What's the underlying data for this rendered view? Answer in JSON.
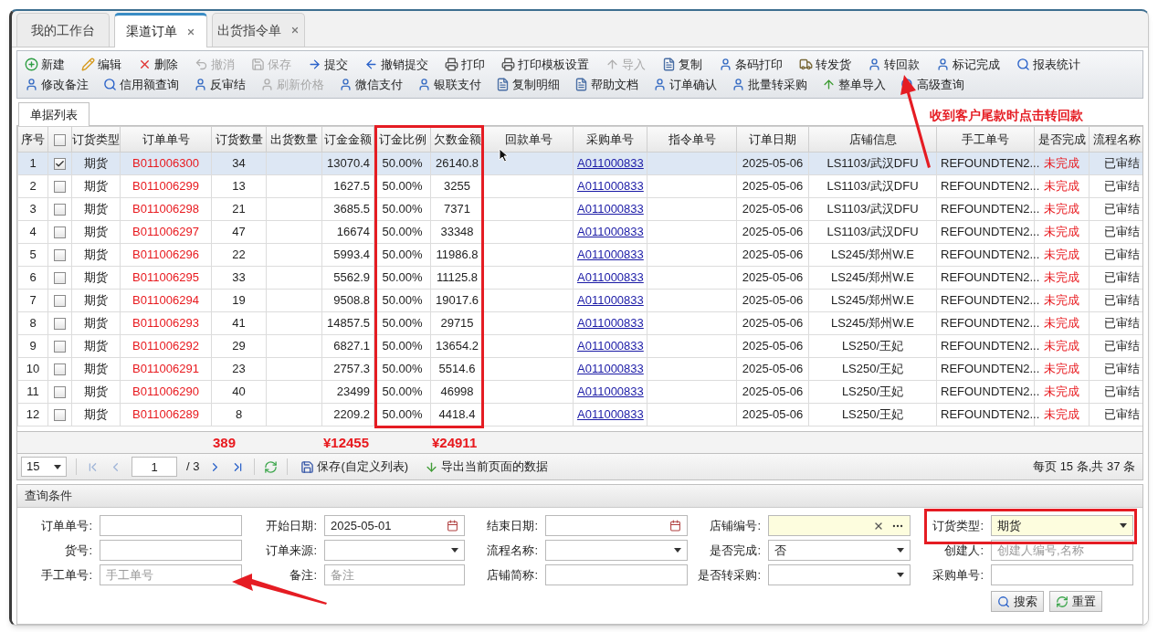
{
  "tabs": [
    {
      "label": "我的工作台",
      "selected": false,
      "closable": false
    },
    {
      "label": "渠道订单",
      "selected": true,
      "closable": true
    },
    {
      "label": "出货指令单",
      "selected": false,
      "closable": true
    }
  ],
  "toolbar": [
    [
      {
        "label": "新建",
        "kind": "add",
        "disabled": false
      },
      {
        "label": "编辑",
        "kind": "edit",
        "disabled": false
      },
      {
        "label": "删除",
        "kind": "delete",
        "disabled": false
      },
      {
        "label": "撤消",
        "kind": "undo",
        "disabled": true
      },
      {
        "label": "保存",
        "kind": "save",
        "disabled": true
      },
      {
        "label": "提交",
        "kind": "forward",
        "disabled": false
      },
      {
        "label": "撤销提交",
        "kind": "back",
        "disabled": false
      },
      {
        "label": "打印",
        "kind": "print",
        "disabled": false
      },
      {
        "label": "打印模板设置",
        "kind": "print",
        "disabled": false
      },
      {
        "label": "导入",
        "kind": "import",
        "disabled": true
      },
      {
        "label": "复制",
        "kind": "doc",
        "disabled": false
      },
      {
        "label": "条码打印",
        "kind": "user",
        "disabled": false
      },
      {
        "label": "转发货",
        "kind": "truck",
        "disabled": false
      },
      {
        "label": "转回款",
        "kind": "user",
        "disabled": false
      },
      {
        "label": "标记完成",
        "kind": "user",
        "disabled": false
      },
      {
        "label": "报表统计",
        "kind": "search",
        "disabled": false
      }
    ],
    [
      {
        "label": "修改备注",
        "kind": "user",
        "disabled": false
      },
      {
        "label": "信用额查询",
        "kind": "search",
        "disabled": false
      },
      {
        "label": "反审结",
        "kind": "user",
        "disabled": false
      },
      {
        "label": "刷新价格",
        "kind": "user",
        "disabled": true
      },
      {
        "label": "微信支付",
        "kind": "user",
        "disabled": false
      },
      {
        "label": "银联支付",
        "kind": "user",
        "disabled": false
      },
      {
        "label": "复制明细",
        "kind": "doc",
        "disabled": false
      },
      {
        "label": "帮助文档",
        "kind": "doc",
        "disabled": false
      },
      {
        "label": "订单确认",
        "kind": "user",
        "disabled": false
      },
      {
        "label": "批量转采购",
        "kind": "user",
        "disabled": false
      },
      {
        "label": "整单导入",
        "kind": "import",
        "disabled": false
      },
      {
        "label": "高级查询",
        "kind": "search",
        "disabled": false
      }
    ]
  ],
  "list_tab": {
    "label": "单据列表",
    "selected": true
  },
  "table": {
    "header_checked": false,
    "columns": [
      {
        "label": "序号",
        "kind": "text"
      },
      {
        "kind": "checkbox"
      },
      {
        "label": "订货类型",
        "kind": "text"
      },
      {
        "label": "订单单号",
        "kind": "red"
      },
      {
        "label": "订货数量",
        "kind": "text"
      },
      {
        "label": "出货数量",
        "kind": "text"
      },
      {
        "label": "订金金额",
        "kind": "text"
      },
      {
        "label": "订金比例",
        "kind": "text"
      },
      {
        "label": "欠数金额",
        "kind": "text"
      },
      {
        "label": "回款单号",
        "kind": "text"
      },
      {
        "label": "采购单号",
        "kind": "link"
      },
      {
        "label": "指令单号",
        "kind": "text"
      },
      {
        "label": "订单日期",
        "kind": "text"
      },
      {
        "label": "店铺信息",
        "kind": "text"
      },
      {
        "label": "手工单号",
        "kind": "text"
      },
      {
        "label": "是否完成",
        "kind": "red"
      },
      {
        "label": "流程名称",
        "kind": "text"
      }
    ],
    "rows": [
      {
        "selected": true,
        "checked": true,
        "seq": "1",
        "type": "期货",
        "order_no": "B011006300",
        "qty": "34",
        "deposit": "13070.4",
        "ratio": "50.00%",
        "owed": "26140.8",
        "purchase_no": "A011000833",
        "date": "2025-05-06",
        "store": "LS1103/武汉DFU",
        "manual_no": "REFOUNDTEN2...",
        "done": "未完成",
        "flow": "已审结"
      },
      {
        "selected": false,
        "checked": false,
        "seq": "2",
        "type": "期货",
        "order_no": "B011006299",
        "qty": "13",
        "deposit": "1627.5",
        "ratio": "50.00%",
        "owed": "3255",
        "purchase_no": "A011000833",
        "date": "2025-05-06",
        "store": "LS1103/武汉DFU",
        "manual_no": "REFOUNDTEN2...",
        "done": "未完成",
        "flow": "已审结"
      },
      {
        "selected": false,
        "checked": false,
        "seq": "3",
        "type": "期货",
        "order_no": "B011006298",
        "qty": "21",
        "deposit": "3685.5",
        "ratio": "50.00%",
        "owed": "7371",
        "purchase_no": "A011000833",
        "date": "2025-05-06",
        "store": "LS1103/武汉DFU",
        "manual_no": "REFOUNDTEN2...",
        "done": "未完成",
        "flow": "已审结"
      },
      {
        "selected": false,
        "checked": false,
        "seq": "4",
        "type": "期货",
        "order_no": "B011006297",
        "qty": "47",
        "deposit": "16674",
        "ratio": "50.00%",
        "owed": "33348",
        "purchase_no": "A011000833",
        "date": "2025-05-06",
        "store": "LS1103/武汉DFU",
        "manual_no": "REFOUNDTEN2...",
        "done": "未完成",
        "flow": "已审结"
      },
      {
        "selected": false,
        "checked": false,
        "seq": "5",
        "type": "期货",
        "order_no": "B011006296",
        "qty": "22",
        "deposit": "5993.4",
        "ratio": "50.00%",
        "owed": "11986.8",
        "purchase_no": "A011000833",
        "date": "2025-05-06",
        "store": "LS245/郑州W.E",
        "manual_no": "REFOUNDTEN2...",
        "done": "未完成",
        "flow": "已审结"
      },
      {
        "selected": false,
        "checked": false,
        "seq": "6",
        "type": "期货",
        "order_no": "B011006295",
        "qty": "33",
        "deposit": "5562.9",
        "ratio": "50.00%",
        "owed": "11125.8",
        "purchase_no": "A011000833",
        "date": "2025-05-06",
        "store": "LS245/郑州W.E",
        "manual_no": "REFOUNDTEN2...",
        "done": "未完成",
        "flow": "已审结"
      },
      {
        "selected": false,
        "checked": false,
        "seq": "7",
        "type": "期货",
        "order_no": "B011006294",
        "qty": "19",
        "deposit": "9508.8",
        "ratio": "50.00%",
        "owed": "19017.6",
        "purchase_no": "A011000833",
        "date": "2025-05-06",
        "store": "LS245/郑州W.E",
        "manual_no": "REFOUNDTEN2...",
        "done": "未完成",
        "flow": "已审结"
      },
      {
        "selected": false,
        "checked": false,
        "seq": "8",
        "type": "期货",
        "order_no": "B011006293",
        "qty": "41",
        "deposit": "14857.5",
        "ratio": "50.00%",
        "owed": "29715",
        "purchase_no": "A011000833",
        "date": "2025-05-06",
        "store": "LS245/郑州W.E",
        "manual_no": "REFOUNDTEN2...",
        "done": "未完成",
        "flow": "已审结"
      },
      {
        "selected": false,
        "checked": false,
        "seq": "9",
        "type": "期货",
        "order_no": "B011006292",
        "qty": "29",
        "deposit": "6827.1",
        "ratio": "50.00%",
        "owed": "13654.2",
        "purchase_no": "A011000833",
        "date": "2025-05-06",
        "store": "LS250/王妃",
        "manual_no": "REFOUNDTEN2...",
        "done": "未完成",
        "flow": "已审结"
      },
      {
        "selected": false,
        "checked": false,
        "seq": "10",
        "type": "期货",
        "order_no": "B011006291",
        "qty": "23",
        "deposit": "2757.3",
        "ratio": "50.00%",
        "owed": "5514.6",
        "purchase_no": "A011000833",
        "date": "2025-05-06",
        "store": "LS250/王妃",
        "manual_no": "REFOUNDTEN2...",
        "done": "未完成",
        "flow": "已审结"
      },
      {
        "selected": false,
        "checked": false,
        "seq": "11",
        "type": "期货",
        "order_no": "B011006290",
        "qty": "40",
        "deposit": "23499",
        "ratio": "50.00%",
        "owed": "46998",
        "purchase_no": "A011000833",
        "date": "2025-05-06",
        "store": "LS250/王妃",
        "manual_no": "REFOUNDTEN2...",
        "done": "未完成",
        "flow": "已审结"
      },
      {
        "selected": false,
        "checked": false,
        "seq": "12",
        "type": "期货",
        "order_no": "B011006289",
        "qty": "8",
        "deposit": "2209.2",
        "ratio": "50.00%",
        "owed": "4418.4",
        "purchase_no": "A011000833",
        "date": "2025-05-06",
        "store": "LS250/王妃",
        "manual_no": "REFOUNDTEN2...",
        "done": "未完成",
        "flow": "已审结"
      }
    ],
    "totals": {
      "qty": "389",
      "deposit": "¥12455",
      "owed": "¥24911"
    }
  },
  "pager": {
    "page_size": "15",
    "page": "1",
    "page_count": "/ 3",
    "buttons": [
      {
        "label": "保存(自定义列表)",
        "kind": "save"
      },
      {
        "label": "导出当前页面的数据",
        "kind": "down"
      }
    ],
    "summary": "每页 15 条,共 37 条"
  },
  "query": {
    "title": "查询条件",
    "fields": [
      {
        "label": "订单单号:",
        "kind": "text",
        "highlighted": false
      },
      {
        "label": "开始日期:",
        "kind": "date",
        "value": "2025-05-01",
        "highlighted": false
      },
      {
        "label": "结束日期:",
        "kind": "date",
        "highlighted": false
      },
      {
        "label": "店铺编号:",
        "kind": "lookup",
        "highlighted": true
      },
      {
        "label": "订货类型:",
        "kind": "select",
        "value": "期货",
        "highlighted": true
      },
      {
        "label": "货号:",
        "kind": "text",
        "highlighted": false
      },
      {
        "label": "订单来源:",
        "kind": "select",
        "highlighted": false
      },
      {
        "label": "流程名称:",
        "kind": "select",
        "highlighted": false
      },
      {
        "label": "是否完成:",
        "kind": "select",
        "value": "否",
        "highlighted": false
      },
      {
        "label": "创建人:",
        "kind": "text",
        "placeholder": "创建人编号,名称",
        "highlighted": false
      },
      {
        "label": "手工单号:",
        "kind": "text",
        "placeholder": "手工单号",
        "highlighted": false
      },
      {
        "label": "备注:",
        "kind": "text",
        "placeholder": "备注",
        "highlighted": false
      },
      {
        "label": "店铺简称:",
        "kind": "text",
        "highlighted": false
      },
      {
        "label": "是否转采购:",
        "kind": "select",
        "highlighted": false
      },
      {
        "label": "采购单号:",
        "kind": "text",
        "highlighted": false
      }
    ],
    "buttons": [
      {
        "label": "搜索",
        "kind": "search"
      },
      {
        "label": "重置",
        "kind": "refresh"
      }
    ]
  },
  "annotation": {
    "text": "收到客户尾款时点击转回款"
  }
}
